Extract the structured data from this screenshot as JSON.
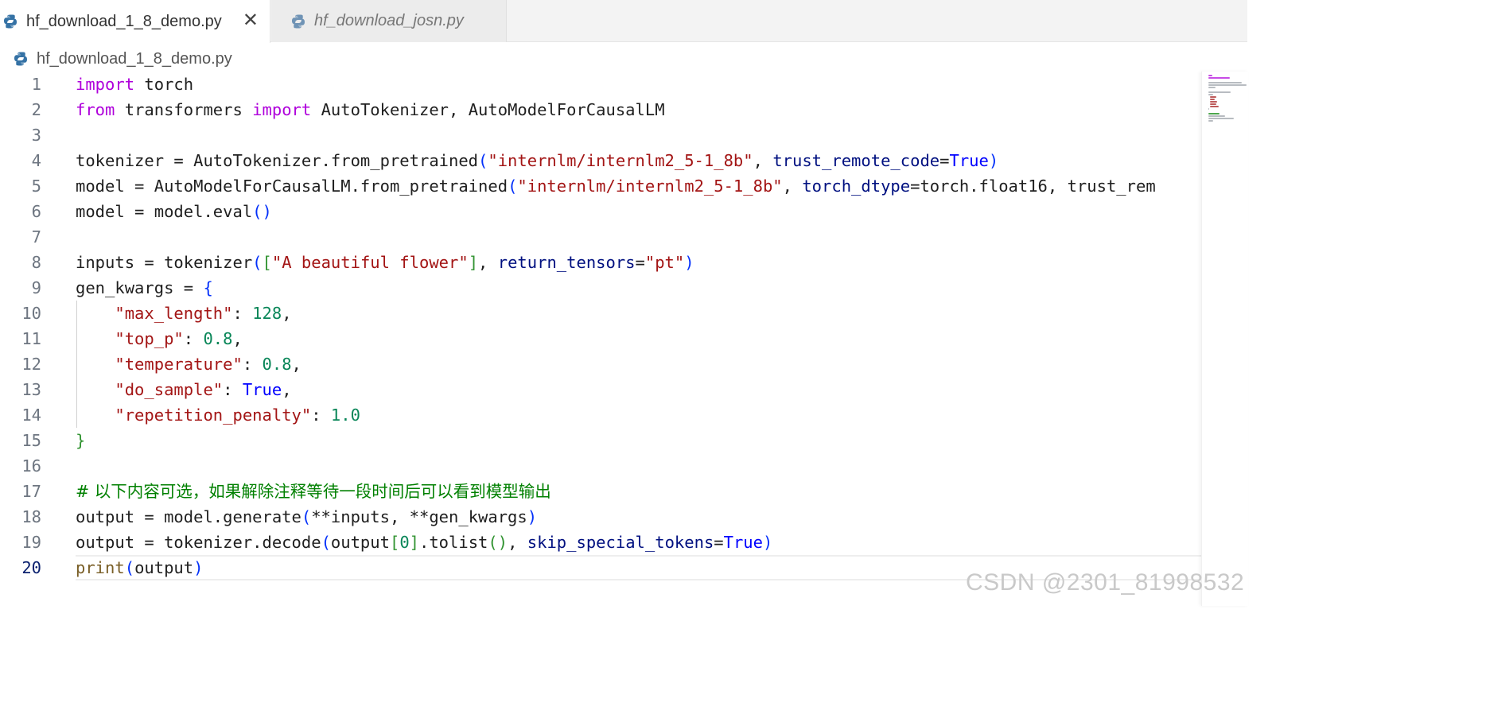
{
  "tabs": [
    {
      "label": "hf_download_1_8_demo.py",
      "active": true,
      "icon": "python-icon",
      "close_icon": "close-icon"
    },
    {
      "label": "hf_download_josn.py",
      "active": false,
      "icon": "python-icon"
    }
  ],
  "close_glyph": "✕",
  "breadcrumb": {
    "file": "hf_download_1_8_demo.py",
    "icon": "python-icon"
  },
  "editor": {
    "current_line": 20,
    "line_numbers": [
      "1",
      "2",
      "3",
      "4",
      "5",
      "6",
      "7",
      "8",
      "9",
      "10",
      "11",
      "12",
      "13",
      "14",
      "15",
      "16",
      "17",
      "18",
      "19",
      "20"
    ],
    "lines": [
      "import torch",
      "from transformers import AutoTokenizer, AutoModelForCausalLM",
      "",
      "tokenizer = AutoTokenizer.from_pretrained(\"internlm/internlm2_5-1_8b\", trust_remote_code=True)",
      "model = AutoModelForCausalLM.from_pretrained(\"internlm/internlm2_5-1_8b\", torch_dtype=torch.float16, trust_rem",
      "model = model.eval()",
      "",
      "inputs = tokenizer([\"A beautiful flower\"], return_tensors=\"pt\")",
      "gen_kwargs = {",
      "    \"max_length\": 128,",
      "    \"top_p\": 0.8,",
      "    \"temperature\": 0.8,",
      "    \"do_sample\": True,",
      "    \"repetition_penalty\": 1.0",
      "}",
      "",
      "# 以下内容可选，如果解除注释等待一段时间后可以看到模型输出",
      "output = model.generate(**inputs, **gen_kwargs)",
      "output = tokenizer.decode(output[0].tolist(), skip_special_tokens=True)",
      "print(output)"
    ]
  },
  "colors": {
    "keyword": "#af00db",
    "function": "#795e26",
    "string": "#a31515",
    "number": "#098658",
    "parameter": "#001080",
    "constant": "#0000ff",
    "comment": "#008000",
    "bracket_1": "#0431fa",
    "bracket_2": "#319331"
  },
  "watermark": "CSDN @2301_81998532"
}
